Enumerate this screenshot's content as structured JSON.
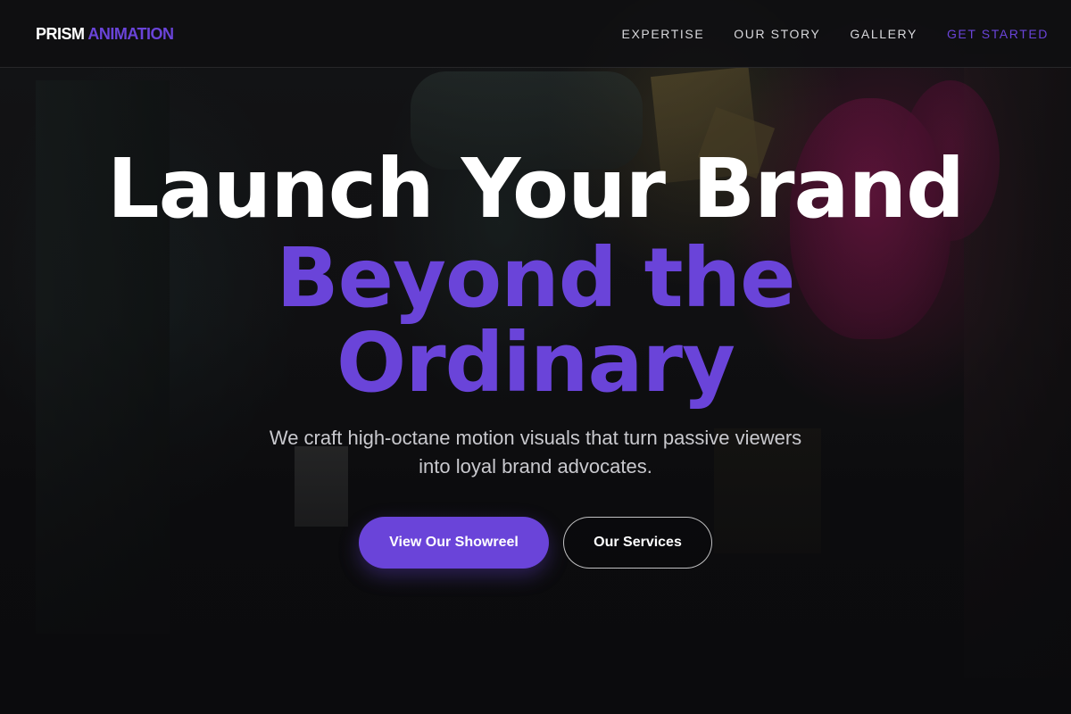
{
  "brand": {
    "logo_primary": "PRISM",
    "logo_accent": "ANIMATION",
    "accent_color": "#6a44d9"
  },
  "nav": {
    "links": [
      {
        "label": "EXPERTISE"
      },
      {
        "label": "OUR STORY"
      },
      {
        "label": "GALLERY"
      },
      {
        "label": "GET STARTED"
      }
    ]
  },
  "hero": {
    "headline_line1": "Launch Your Brand",
    "headline_line2": "Beyond the",
    "headline_line3": "Ordinary",
    "subtitle": "We craft high-octane motion visuals that turn passive viewers into loyal brand advocates.",
    "primary_button": "View Our Showreel",
    "secondary_button": "Our Services"
  }
}
